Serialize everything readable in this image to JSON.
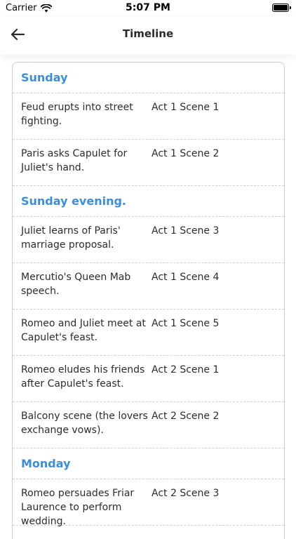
{
  "status_bar": {
    "carrier": "Carrier",
    "time": "5:07 PM"
  },
  "nav": {
    "title": "Timeline",
    "back_icon": "arrow-left-icon"
  },
  "timeline": {
    "sunday": {
      "label": "Sunday",
      "events": [
        {
          "description": "Feud erupts into street fighting.",
          "scene": "Act 1 Scene 1"
        },
        {
          "description": "Paris asks Capulet for Juliet's hand.",
          "scene": "Act 1 Scene 2"
        }
      ]
    },
    "sunday_evening": {
      "label": "Sunday evening.",
      "events": [
        {
          "description": "Juliet learns of Paris' marriage proposal.",
          "scene": "Act 1 Scene 3"
        },
        {
          "description": "Mercutio's Queen Mab speech.",
          "scene": "Act 1 Scene 4"
        },
        {
          "description": "Romeo and Juliet meet at Capulet's feast.",
          "scene": "Act 1 Scene 5"
        },
        {
          "description": "Romeo eludes his friends after Capulet's feast.",
          "scene": "Act 2 Scene 1"
        },
        {
          "description": "Balcony scene (the lovers exchange vows).",
          "scene": "Act 2 Scene 2"
        }
      ]
    },
    "monday": {
      "label": "Monday",
      "events": [
        {
          "description": "Romeo persuades Friar Laurence to perform wedding.",
          "scene": "Act 2 Scene 3"
        }
      ]
    }
  },
  "colors": {
    "accent": "#3a8edc",
    "divider": "#cfcfcf"
  }
}
